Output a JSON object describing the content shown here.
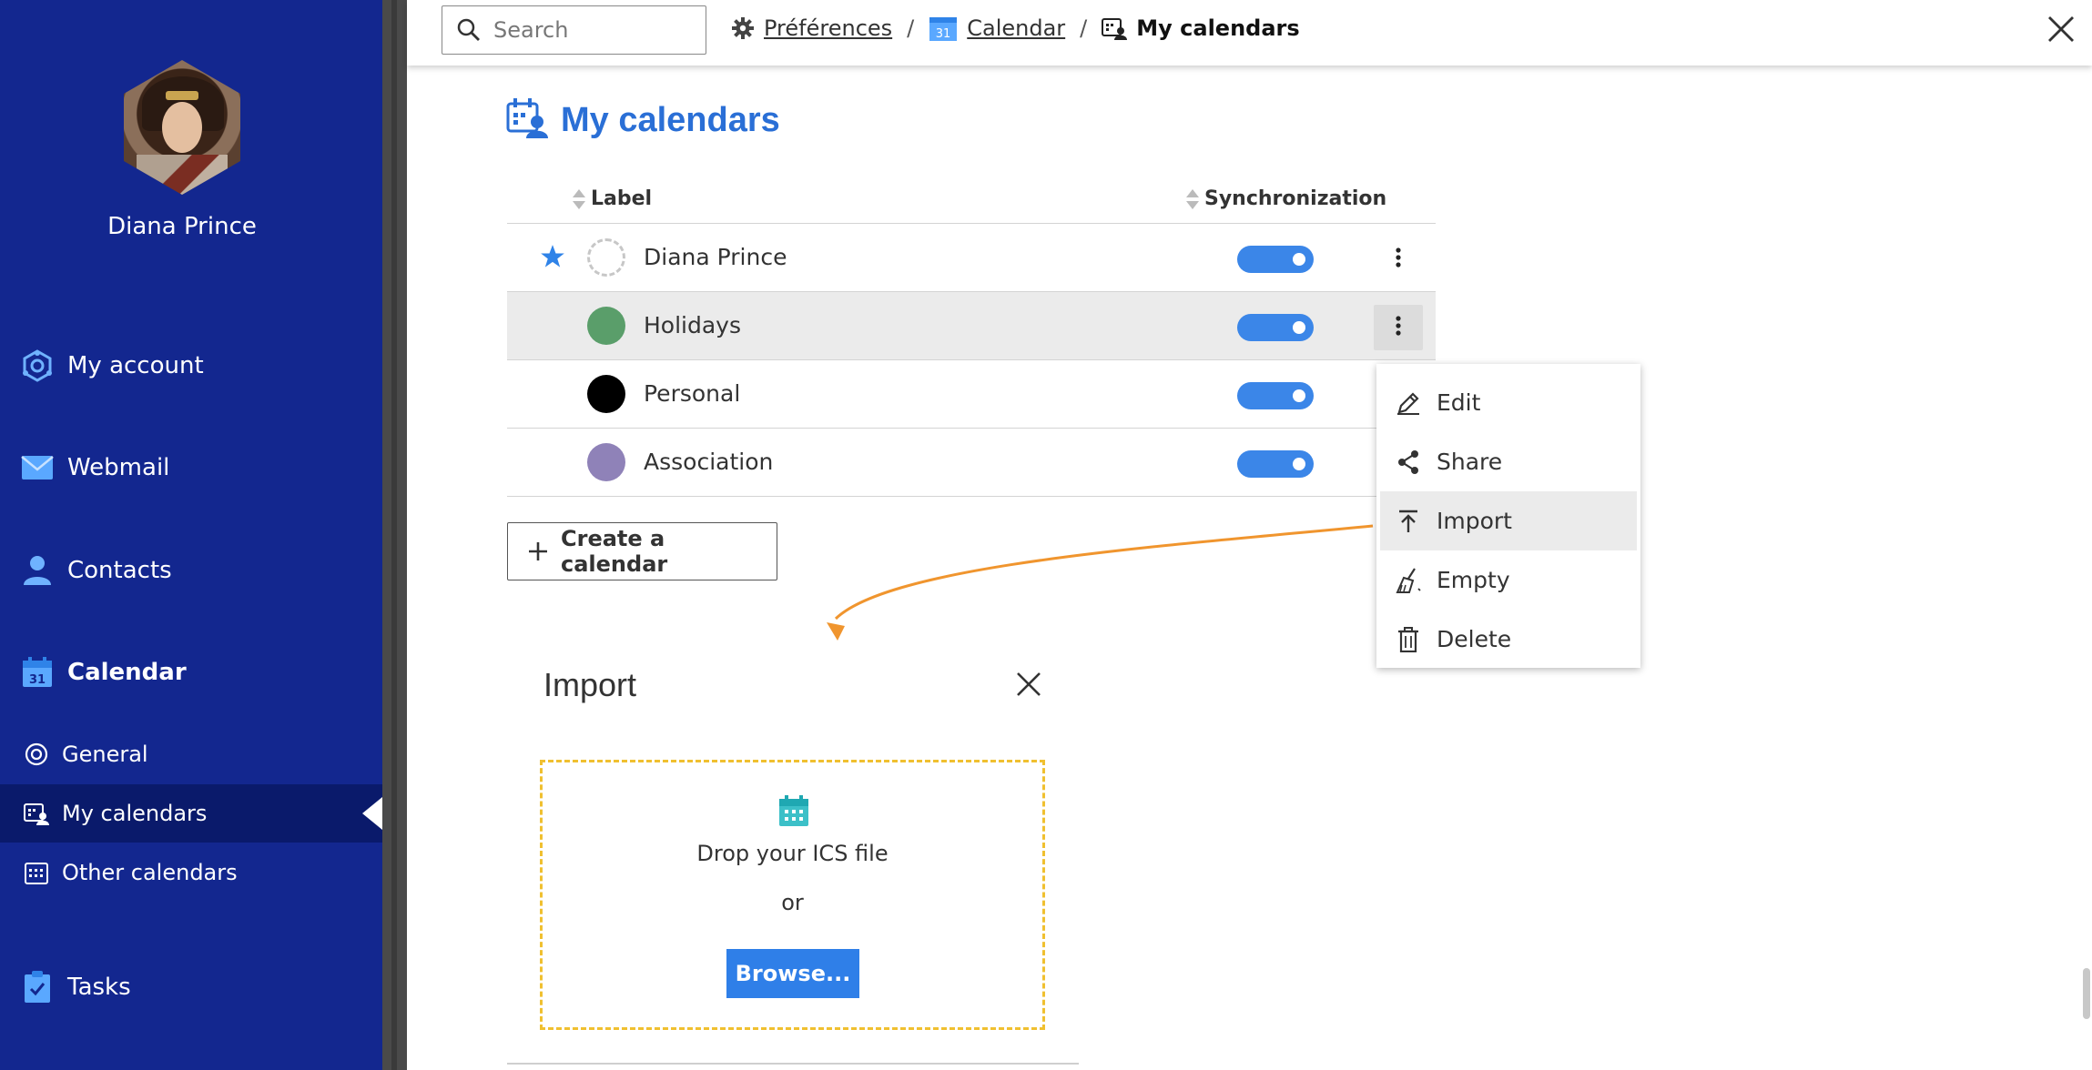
{
  "user": {
    "name": "Diana Prince"
  },
  "nav": {
    "my_account": "My account",
    "webmail": "Webmail",
    "contacts": "Contacts",
    "calendar": "Calendar",
    "tasks": "Tasks",
    "sub": {
      "general": "General",
      "my_calendars": "My calendars",
      "other_calendars": "Other calendars"
    }
  },
  "topbar": {
    "search_placeholder": "Search",
    "breadcrumb": {
      "preferences": "Préférences",
      "calendar": "Calendar",
      "current": "My calendars",
      "separator": "/"
    },
    "calendar_icon_day": "31"
  },
  "page": {
    "title": "My calendars"
  },
  "table": {
    "headers": {
      "label": "Label",
      "sync": "Synchronization"
    },
    "rows": [
      {
        "label": "Diana Prince",
        "default": true,
        "color": "none",
        "sync": true
      },
      {
        "label": "Holidays",
        "default": false,
        "color": "#5a9e6a",
        "sync": true
      },
      {
        "label": "Personal",
        "default": false,
        "color": "#000000",
        "sync": true
      },
      {
        "label": "Association",
        "default": false,
        "color": "#8f82b8",
        "sync": true
      }
    ]
  },
  "create_button": "Create a calendar",
  "context_menu": {
    "items": [
      {
        "label": "Edit",
        "icon": "pencil-icon"
      },
      {
        "label": "Share",
        "icon": "share-icon"
      },
      {
        "label": "Import",
        "icon": "upload-icon"
      },
      {
        "label": "Empty",
        "icon": "broom-icon"
      },
      {
        "label": "Delete",
        "icon": "trash-icon"
      }
    ]
  },
  "import_dialog": {
    "title": "Import",
    "drop_text": "Drop your ICS file",
    "or_text": "or",
    "browse_label": "Browse..."
  },
  "colors": {
    "sidebar_bg": "#13278f",
    "accent_blue": "#2a6fd6",
    "toggle_on": "#3b86e8",
    "arrow": "#f0952e",
    "dropzone_border": "#f0c030"
  }
}
